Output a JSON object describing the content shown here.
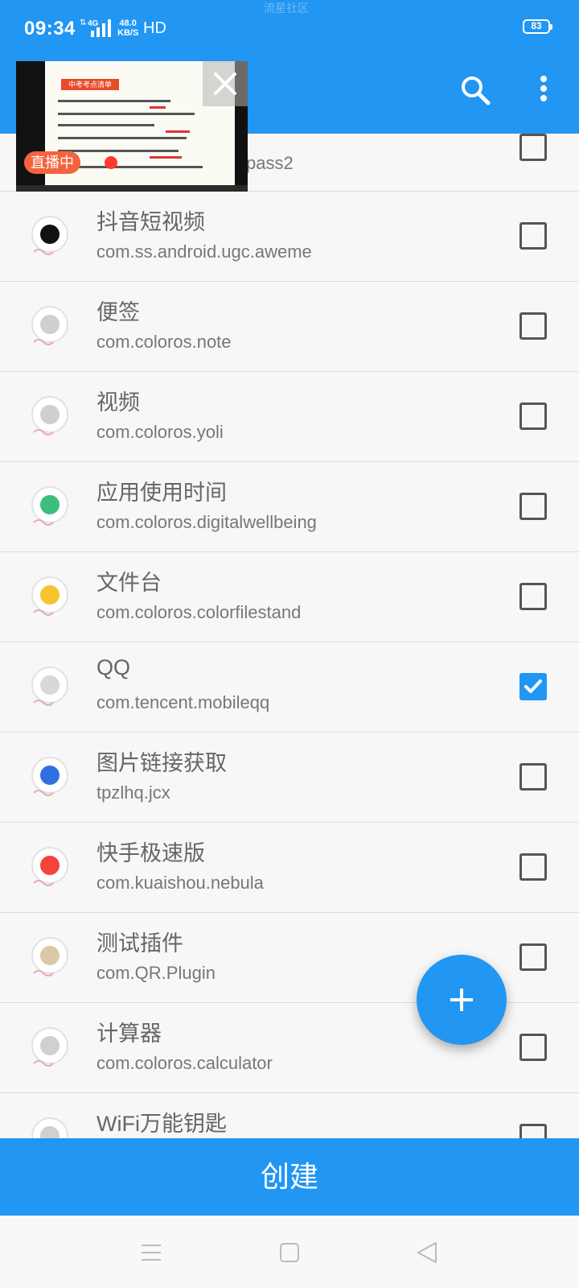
{
  "status_bar": {
    "time": "09:34",
    "network": "4G",
    "speed_value": "48.0",
    "speed_unit": "KB/S",
    "hd": "HD",
    "battery": "83",
    "watermark": "流星社区"
  },
  "toolbar": {
    "search_icon": "search-icon",
    "more_icon": "more-vert-icon"
  },
  "pip": {
    "badge": "直播中",
    "slide_header": "中考考点清单"
  },
  "list": {
    "partial_row": {
      "pkg": "pass2",
      "checked": false
    },
    "items": [
      {
        "label": "抖音短视频",
        "pkg": "com.ss.android.ugc.aweme",
        "checked": false,
        "icon": "douyin-icon",
        "accent": "#111111"
      },
      {
        "label": "便签",
        "pkg": "com.coloros.note",
        "checked": false,
        "icon": "note-icon",
        "accent": "#cfcfcf"
      },
      {
        "label": "视频",
        "pkg": "com.coloros.yoli",
        "checked": false,
        "icon": "video-icon",
        "accent": "#cfcfcf"
      },
      {
        "label": "应用使用时间",
        "pkg": "com.coloros.digitalwellbeing",
        "checked": false,
        "icon": "digital-wellbeing-icon",
        "accent": "#3bbf7a"
      },
      {
        "label": "文件台",
        "pkg": "com.coloros.colorfilestand",
        "checked": false,
        "icon": "file-stand-icon",
        "accent": "#f4c531"
      },
      {
        "label": "QQ",
        "pkg": "com.tencent.mobileqq",
        "checked": true,
        "icon": "qq-icon",
        "accent": "#d8d8d8"
      },
      {
        "label": "图片链接获取",
        "pkg": "tpzlhq.jcx",
        "checked": false,
        "icon": "image-link-icon",
        "accent": "#2f6fe0"
      },
      {
        "label": "快手极速版",
        "pkg": "com.kuaishou.nebula",
        "checked": false,
        "icon": "kuaishou-icon",
        "accent": "#f3443b"
      },
      {
        "label": "测试插件",
        "pkg": "com.QR.Plugin",
        "checked": false,
        "icon": "test-plugin-icon",
        "accent": "#d9c9a8"
      },
      {
        "label": "计算器",
        "pkg": "com.coloros.calculator",
        "checked": false,
        "icon": "calculator-icon",
        "accent": "#d0d0d0"
      },
      {
        "label": "WiFi万能钥匙",
        "pkg": "",
        "checked": false,
        "icon": "wifi-key-icon",
        "accent": "#d0d0d0"
      }
    ]
  },
  "fab": {
    "symbol": "+"
  },
  "create_button": {
    "label": "创建"
  },
  "colors": {
    "primary": "#2196f3",
    "badge": "#f5623d"
  }
}
